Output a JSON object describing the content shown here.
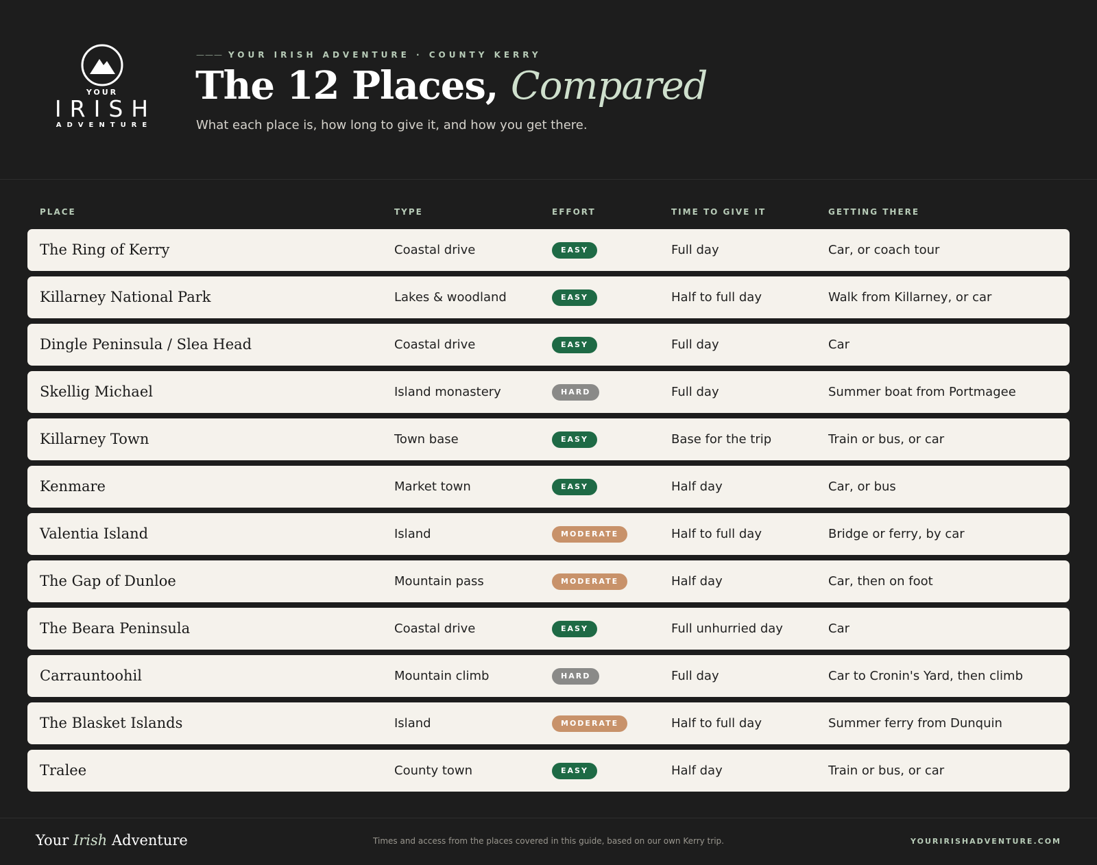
{
  "brand": {
    "logo_top": "YOUR",
    "logo_main": "IRISH",
    "logo_bottom": "ADVENTURE",
    "kicker_dash": "———",
    "kicker": "YOUR IRISH ADVENTURE · COUNTY KERRY"
  },
  "header": {
    "title_main": "The 12 Places,",
    "title_accent": "Compared",
    "subtitle": "What each place is, how long to give it, and how you get there."
  },
  "table": {
    "columns": [
      "PLACE",
      "TYPE",
      "EFFORT",
      "TIME TO GIVE IT",
      "GETTING THERE"
    ],
    "rows": [
      {
        "place": "The Ring of Kerry",
        "type": "Coastal drive",
        "effort": "EASY",
        "time": "Full day",
        "getting": "Car, or coach tour"
      },
      {
        "place": "Killarney National Park",
        "type": "Lakes & woodland",
        "effort": "EASY",
        "time": "Half to full day",
        "getting": "Walk from Killarney, or car"
      },
      {
        "place": "Dingle Peninsula / Slea Head",
        "type": "Coastal drive",
        "effort": "EASY",
        "time": "Full day",
        "getting": "Car"
      },
      {
        "place": "Skellig Michael",
        "type": "Island monastery",
        "effort": "HARD",
        "time": "Full day",
        "getting": "Summer boat from Portmagee"
      },
      {
        "place": "Killarney Town",
        "type": "Town base",
        "effort": "EASY",
        "time": "Base for the trip",
        "getting": "Train or bus, or car"
      },
      {
        "place": "Kenmare",
        "type": "Market town",
        "effort": "EASY",
        "time": "Half day",
        "getting": "Car, or bus"
      },
      {
        "place": "Valentia Island",
        "type": "Island",
        "effort": "MODERATE",
        "time": "Half to full day",
        "getting": "Bridge or ferry, by car"
      },
      {
        "place": "The Gap of Dunloe",
        "type": "Mountain pass",
        "effort": "MODERATE",
        "time": "Half day",
        "getting": "Car, then on foot"
      },
      {
        "place": "The Beara Peninsula",
        "type": "Coastal drive",
        "effort": "EASY",
        "time": "Full unhurried day",
        "getting": "Car"
      },
      {
        "place": "Carrauntoohil",
        "type": "Mountain climb",
        "effort": "HARD",
        "time": "Full day",
        "getting": "Car to Cronin's Yard, then climb"
      },
      {
        "place": "The Blasket Islands",
        "type": "Island",
        "effort": "MODERATE",
        "time": "Half to full day",
        "getting": "Summer ferry from Dunquin"
      },
      {
        "place": "Tralee",
        "type": "County town",
        "effort": "EASY",
        "time": "Half day",
        "getting": "Train or bus, or car"
      }
    ]
  },
  "footer": {
    "brand_pre": "Your",
    "brand_accent": "Irish",
    "brand_post": "Adventure",
    "note": "Times and access from the places covered in this guide, based on our own Kerry trip.",
    "url": "YOURIRISHADVENTURE.COM"
  },
  "colors": {
    "background": "#1d1d1d",
    "row_bg": "#f5f2ec",
    "accent_green": "#cfe0cd",
    "easy": "#1e6a45",
    "moderate": "#c8926a",
    "hard": "#8a8a88"
  },
  "icons": {
    "logo": "mountain-circle-icon"
  }
}
